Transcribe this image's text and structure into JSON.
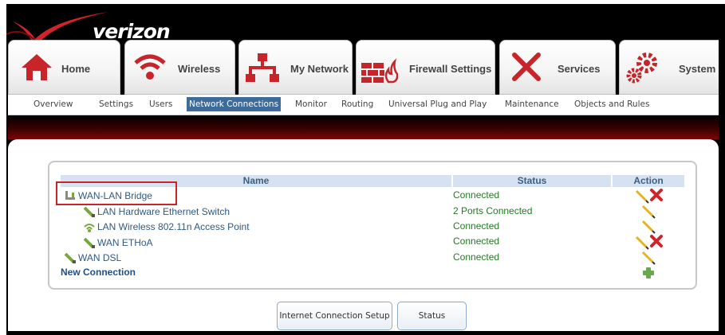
{
  "brand": {
    "logo": "verizon",
    "logo_accent_color": "#d2232a"
  },
  "main_tabs": [
    {
      "id": "home",
      "label": "Home",
      "icon": "home-icon"
    },
    {
      "id": "wireless",
      "label": "Wireless",
      "icon": "wifi-icon"
    },
    {
      "id": "my-network",
      "label": "My Network",
      "icon": "network-icon"
    },
    {
      "id": "firewall",
      "label": "Firewall Settings",
      "icon": "firewall-icon"
    },
    {
      "id": "services",
      "label": "Services",
      "icon": "tools-icon"
    },
    {
      "id": "system",
      "label": "System",
      "icon": "gears-icon"
    }
  ],
  "sub_nav": {
    "items": [
      "Overview",
      "Settings",
      "Users",
      "Network Connections",
      "Monitor",
      "Routing",
      "Universal Plug and Play",
      "Maintenance",
      "Objects and Rules"
    ],
    "active": "Network Connections"
  },
  "table": {
    "headers": {
      "name": "Name",
      "status": "Status",
      "action": "Action"
    },
    "rows": [
      {
        "name": "WAN-LAN Bridge",
        "status": "Connected",
        "icon": "bridge-icon",
        "actions": [
          "edit",
          "delete"
        ]
      },
      {
        "name": "LAN Hardware Ethernet Switch",
        "status": "2 Ports Connected",
        "icon": "ethernet-cable-icon",
        "actions": [
          "edit"
        ]
      },
      {
        "name": "LAN Wireless 802.11n Access Point",
        "status": "Connected",
        "icon": "wireless-ap-icon",
        "actions": [
          "edit"
        ]
      },
      {
        "name": "WAN ETHoA",
        "status": "Connected",
        "icon": "ethernet-cable-icon",
        "actions": [
          "edit",
          "delete"
        ]
      },
      {
        "name": "WAN DSL",
        "status": "Connected",
        "icon": "ethernet-cable-icon",
        "actions": [
          "edit"
        ]
      }
    ],
    "new_connection": {
      "label": "New Connection",
      "action": "add"
    }
  },
  "buttons": {
    "internet_setup": "Internet Connection Setup",
    "status": "Status"
  },
  "colors": {
    "accent_blue": "#3d6b9c",
    "status_green": "#237a23",
    "highlight_red": "#c8252b",
    "link_blue": "#2e5a84"
  }
}
